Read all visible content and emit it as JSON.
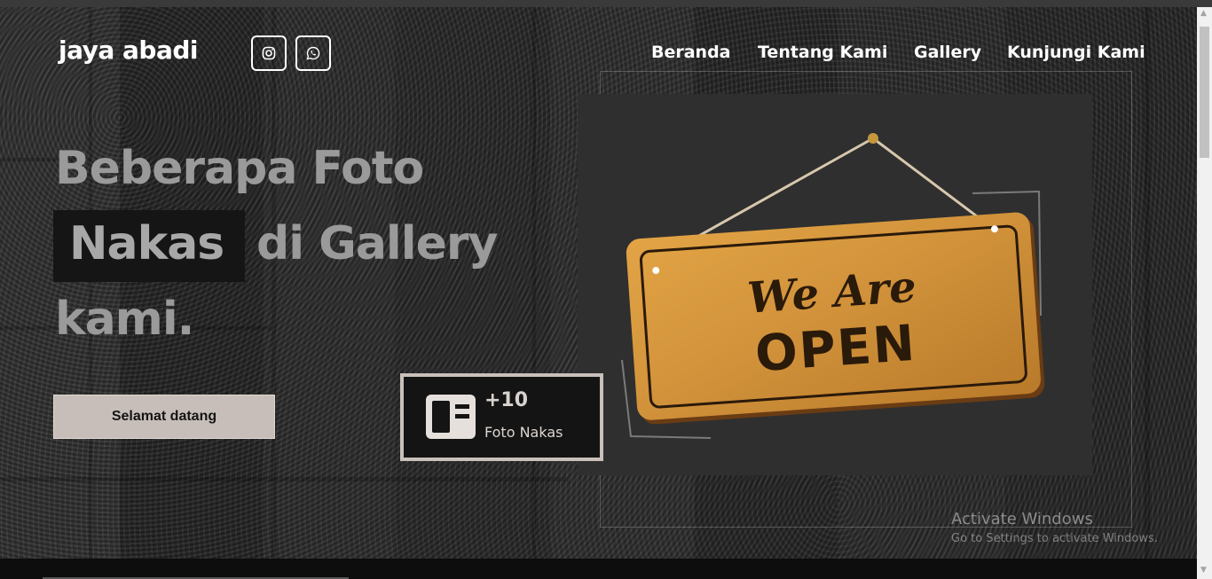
{
  "header": {
    "logo": "jaya abadi",
    "social": [
      {
        "icon": "instagram-icon"
      },
      {
        "icon": "whatsapp-icon"
      }
    ],
    "nav": [
      "Beranda",
      "Tentang Kami",
      "Gallery",
      "Kunjungi Kami"
    ]
  },
  "hero": {
    "headline_line1": "Beberapa Foto",
    "highlight_word": "Nakas",
    "headline_line2_rest": "di Gallery",
    "headline_line3": "kami.",
    "cta_label": "Selamat datang"
  },
  "stat_card": {
    "icon": "layout-icon",
    "number": "+10",
    "label": "Foto Nakas"
  },
  "sign_image": {
    "line1": "We Are",
    "line2": "OPEN"
  },
  "watermark": {
    "title": "Activate Windows",
    "subtitle": "Go to Settings to activate Windows."
  },
  "colors": {
    "accent": "#c7beb9",
    "dark": "#141414",
    "headline": "#9a9a9a",
    "sign_wood": "#d99a3a"
  }
}
